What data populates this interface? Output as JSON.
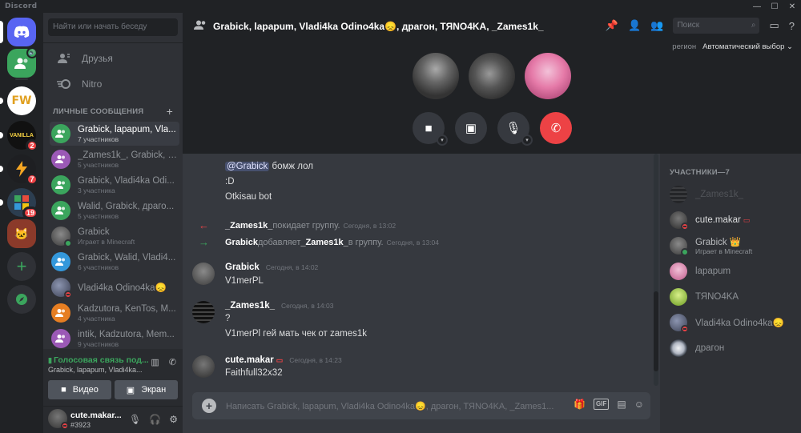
{
  "window": {
    "app_title": "Discord",
    "controls": [
      "—",
      "☐",
      "✕"
    ]
  },
  "servers": [
    {
      "name": "home",
      "color": "#5865f2",
      "badge": ""
    },
    {
      "name": "voice-active",
      "color": "#3ba55d",
      "badge": ""
    },
    {
      "name": "fw",
      "color": "#f0f0f0",
      "badge": ""
    },
    {
      "name": "vanilla",
      "color": "#111111",
      "badge": "2"
    },
    {
      "name": "bolt",
      "color": "#202225",
      "badge": "7"
    },
    {
      "name": "games",
      "color": "#2c3e50",
      "badge": "19"
    },
    {
      "name": "cats",
      "color": "#8b3a2a",
      "badge": ""
    }
  ],
  "sidebar": {
    "search_placeholder": "Найти или начать беседу",
    "nav": [
      {
        "label": "Друзья",
        "icon": "friends-icon"
      },
      {
        "label": "Nitro",
        "icon": "nitro-icon"
      }
    ],
    "dm_header": "ЛИЧНЫЕ СООБЩЕНИЯ",
    "dm_plus": "+",
    "dms": [
      {
        "name": "Grabick, lapapum, Vla...",
        "sub": "7 участников",
        "color": "#3ba55d",
        "group": true
      },
      {
        "name": "_Zames1k_, Grabick, V...",
        "sub": "5 участников",
        "color": "#9b59b6",
        "group": true
      },
      {
        "name": "Grabick, Vladi4ka Odi...",
        "sub": "3 участника",
        "color": "#3ba55d",
        "group": true
      },
      {
        "name": "Walid, Grabick, драго...",
        "sub": "5 участников",
        "color": "#3ba55d",
        "group": true
      },
      {
        "name": "Grabick",
        "sub": "Играет в Minecraft",
        "color": "#5a5a5a",
        "group": false
      },
      {
        "name": "Grabick, Walid, Vladi4...",
        "sub": "6 участников",
        "color": "#3498db",
        "group": true
      },
      {
        "name": "Vladi4ka Odino4ka😞",
        "sub": "",
        "color": "#4a4f63",
        "group": false
      },
      {
        "name": "Kadzutora, KenTos, M...",
        "sub": "4 участника",
        "color": "#e67e22",
        "group": true
      },
      {
        "name": "intik, Kadzutora, Mem...",
        "sub": "9 участников",
        "color": "#9b59b6",
        "group": true
      }
    ],
    "voice": {
      "status": "Голосовая связь под...",
      "channel": "Grabick, lapapum, Vladi4ka...",
      "video_label": "Видео",
      "screen_label": "Экран"
    },
    "user": {
      "name": "cute.makar...",
      "tag": "#3923"
    }
  },
  "header": {
    "title": "Grabick, lapapum, Vladi4ka Odino4ka😞, драгон, ТЯNO4KA, _Zames1k_",
    "search_placeholder": "Поиск"
  },
  "call": {
    "region_label": "регион",
    "region_value": "Автоматический выбор ⌄"
  },
  "chat": {
    "partial_lines": [
      {
        "mention": "@Grabick",
        "text": " бомж лол"
      },
      {
        "text": ":D"
      },
      {
        "text": "Otkisau bot"
      }
    ],
    "system": [
      {
        "user": "_Zames1k_",
        "action": " покидает группу.",
        "target": "",
        "tail": "",
        "time": "Сегодня, в 13:02",
        "arrow": "←",
        "arrow_color": "#ed4245"
      },
      {
        "user": "Grabick",
        "action": " добавляет ",
        "target": "_Zames1k_",
        "tail": " в группу.",
        "time": "Сегодня, в 13:04",
        "arrow": "→",
        "arrow_color": "#3ba55d"
      }
    ],
    "messages": [
      {
        "author": "Grabick",
        "time": "Сегодня, в 14:02",
        "lines": [
          "V1merPL"
        ]
      },
      {
        "author": "_Zames1k_",
        "time": "Сегодня, в 14:03",
        "lines": [
          "?",
          "V1merPl  гей мать чек от zames1k"
        ]
      },
      {
        "author": "cute.makar",
        "time": "Сегодня, в 14:23",
        "lines": [
          "Faithfull32x32"
        ]
      }
    ],
    "composer_placeholder": "Написать Grabick, lapapum, Vladi4ka Odino4ka😞, драгон, ТЯNO4KA, _Zames1..."
  },
  "members": {
    "header": "УЧАСТНИКИ—7",
    "list": [
      {
        "name": "_Zames1k_",
        "sub": "",
        "status": "offline",
        "color": "#555"
      },
      {
        "name": "cute.makar",
        "sub": "",
        "status": "dnd",
        "color": "#4a4d52"
      },
      {
        "name": "Grabick 👑",
        "sub": "Играет в Minecraft",
        "status": "online",
        "color": "#5a5a5a"
      },
      {
        "name": "lapapum",
        "sub": "",
        "status": "none",
        "color": "#e8a6c8"
      },
      {
        "name": "ТЯNO4KA",
        "sub": "",
        "status": "none",
        "color": "#9acd32"
      },
      {
        "name": "Vladi4ka Odino4ka😞",
        "sub": "",
        "status": "dnd",
        "color": "#4a4f63"
      },
      {
        "name": "драгон",
        "sub": "",
        "status": "none",
        "color": "#d0d4dc"
      }
    ]
  }
}
